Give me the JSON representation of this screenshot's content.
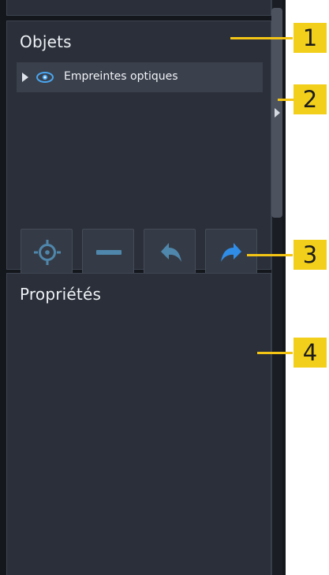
{
  "objects_panel": {
    "title": "Objets",
    "tree_items": [
      {
        "label": "Empreintes optiques",
        "visibility_icon": "eye-icon",
        "expand_icon": "triangle-right-icon"
      }
    ]
  },
  "properties_panel": {
    "title": "Propriétés"
  },
  "toolbar": {
    "buttons": [
      {
        "icon": "crosshair-target-icon",
        "enabled": false
      },
      {
        "icon": "minus-icon",
        "enabled": false
      },
      {
        "icon": "undo-arrow-icon",
        "enabled": false
      },
      {
        "icon": "redo-arrow-icon",
        "enabled": true
      }
    ]
  },
  "callouts": [
    "1",
    "2",
    "3",
    "4"
  ],
  "colors": {
    "callout": "#f2cf1a",
    "panel_bg": "#2a2f39",
    "text": "#eef1f5",
    "accent_blue": "#3f9bea"
  }
}
